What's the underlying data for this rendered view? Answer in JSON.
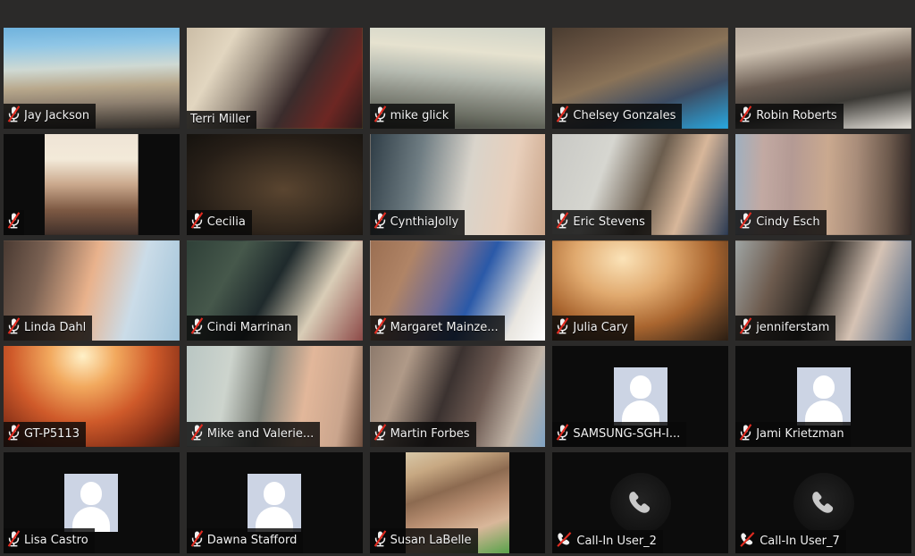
{
  "app": {
    "title": "Zoom Meeting - Gallery View",
    "background_color": "#2b2a29",
    "tile_background_color": "#0c0c0c",
    "active_speaker_border_color": "#b9df4b",
    "mute_slash_color": "#e02b20",
    "avatar_background_color": "#ccd4e4"
  },
  "icons": {
    "muted_mic": "microphone-muted-icon",
    "muted_phone": "phone-muted-icon",
    "avatar": "person-avatar-icon"
  },
  "grid": {
    "columns": 5,
    "rows": 5,
    "participant_count": 25
  },
  "participants": [
    {
      "name": "Jay Jackson",
      "has_video": true,
      "muted": true,
      "audio_type": "computer",
      "active_speaker": false,
      "video_style": "fill",
      "video_css": "linear-gradient(178deg,#6fb2dd 0%,#8fc6e6 18%,#cfd9d3 40%,#b8a88c 58%,#8e8070 74%,#2e2a26 100%)"
    },
    {
      "name": "Terri Miller",
      "has_video": true,
      "muted": false,
      "audio_type": "computer",
      "active_speaker": true,
      "video_style": "fill",
      "video_css": "linear-gradient(120deg,#cbbda6 0%,#e2d6c0 22%,#9f9384 40%,#3a2c2c 62%,#6d2723 82%,#2a1a1a 100%)"
    },
    {
      "name": "mike glick",
      "has_video": true,
      "muted": true,
      "audio_type": "computer",
      "active_speaker": false,
      "video_style": "fill",
      "video_css": "linear-gradient(185deg,#cfd3c8 0%,#e6e2cf 26%,#b7bcb2 48%,#8d9086 66%,#6a6d62 82%,#3a3c36 100%)"
    },
    {
      "name": "Chelsey Gonzales",
      "has_video": true,
      "muted": true,
      "audio_type": "computer",
      "active_speaker": false,
      "video_style": "fill",
      "video_css": "linear-gradient(160deg,#4a3c30 0%,#6b5644 25%,#8a7358 45%,#3c4c63 70%,#29a8e0 100%)"
    },
    {
      "name": "Robin Roberts",
      "has_video": true,
      "muted": true,
      "audio_type": "computer",
      "active_speaker": false,
      "video_style": "fill",
      "video_css": "linear-gradient(170deg,#b6aa9d 0%,#cbbfaf 22%,#6a5c52 48%,#3c3a36 70%,#e8e4dd 100%)"
    },
    {
      "name": "",
      "has_video": true,
      "muted": true,
      "audio_type": "computer",
      "active_speaker": false,
      "video_style": "portrait",
      "video_css": "linear-gradient(180deg,#efe4d6 0%,#f3ead9 25%,#caa88c 50%,#7e5a44 75%,#40302a 100%)"
    },
    {
      "name": "Cecilia",
      "has_video": true,
      "muted": true,
      "audio_type": "computer",
      "active_speaker": false,
      "video_style": "fill",
      "video_css": "radial-gradient(ellipse at 55% 55%,#5a4530 0%,#3c2f22 38%,#261e17 66%,#15120e 100%)"
    },
    {
      "name": "CynthiaJolly",
      "has_video": true,
      "muted": true,
      "audio_type": "computer",
      "active_speaker": false,
      "video_style": "fill",
      "video_css": "linear-gradient(100deg,#2f3d46 0%,#6f7d83 28%,#d9d4cb 55%,#e8cfbb 78%,#c9a489 100%)"
    },
    {
      "name": "Eric Stevens",
      "has_video": true,
      "muted": true,
      "audio_type": "computer",
      "active_speaker": false,
      "video_style": "fill",
      "video_css": "linear-gradient(110deg,#c8c8c4 0%,#d6d6d0 30%,#6b5d4e 55%,#d8b79a 74%,#2b3a52 100%)"
    },
    {
      "name": "Cindy Esch",
      "has_video": true,
      "muted": true,
      "audio_type": "computer",
      "active_speaker": false,
      "video_style": "fill",
      "video_css": "linear-gradient(92deg,#9fb0c0 0%,#c2a9a2 16%,#b49a94 32%,#caa98f 52%,#a98d7a 68%,#6d5a4d 86%,#2d2523 100%)"
    },
    {
      "name": "Linda Dahl",
      "has_video": true,
      "muted": true,
      "audio_type": "computer",
      "active_speaker": false,
      "video_style": "fill",
      "video_css": "linear-gradient(105deg,#4a3a32 0%,#7b6253 22%,#e9b28c 48%,#cbdce8 72%,#9fc2d8 100%)"
    },
    {
      "name": "Cindi Marrinan",
      "has_video": true,
      "muted": true,
      "audio_type": "computer",
      "active_speaker": false,
      "video_style": "fill",
      "video_css": "linear-gradient(120deg,#2f4038 0%,#46584b 26%,#1f2a2c 48%,#d9cdb7 72%,#8d4a48 100%)"
    },
    {
      "name": "Margaret Mainze...",
      "has_video": true,
      "muted": true,
      "audio_type": "computer",
      "active_speaker": false,
      "video_style": "fill",
      "video_css": "linear-gradient(115deg,#9b6f52 0%,#b08466 22%,#6e6a94 44%,#2a59a8 58%,#e9e6e0 82%,#ffffff 100%)"
    },
    {
      "name": "Julia Cary",
      "has_video": true,
      "muted": true,
      "audio_type": "computer",
      "active_speaker": false,
      "video_style": "fill",
      "video_css": "radial-gradient(ellipse at 40% 18%,#fbe3b8 0%,#e0a96e 32%,#a9652f 60%,#5d3b20 82%,#2a1d12 100%)"
    },
    {
      "name": "jenniferstam",
      "has_video": true,
      "muted": true,
      "audio_type": "computer",
      "active_speaker": false,
      "video_style": "fill",
      "video_css": "linear-gradient(110deg,#9fa5a4 0%,#6d5b4e 24%,#2a2622 46%,#d6c3b4 70%,#3e5d83 100%)"
    },
    {
      "name": "GT-P5113",
      "has_video": true,
      "muted": true,
      "audio_type": "computer",
      "active_speaker": false,
      "video_style": "fill",
      "video_css": "radial-gradient(ellipse at 45% 10%,#fff1c8 0%,#f2a95e 24%,#cf5a2a 52%,#8d3419 76%,#3a1a10 100%)"
    },
    {
      "name": "Mike and Valerie...",
      "has_video": true,
      "muted": true,
      "audio_type": "computer",
      "active_speaker": false,
      "video_style": "fill",
      "video_css": "linear-gradient(100deg,#b9c6c3 0%,#cdd4cd 24%,#7d8179 44%,#e2b79a 66%,#caa58d 86%,#6d4f3f 100%)"
    },
    {
      "name": "Martin Forbes",
      "has_video": true,
      "muted": true,
      "audio_type": "computer",
      "active_speaker": false,
      "video_style": "fill",
      "video_css": "linear-gradient(110deg,#8d7a6c 0%,#b09a88 20%,#3b3230 44%,#6d5a52 62%,#c2b5a8 82%,#7fa3c4 100%)"
    },
    {
      "name": "SAMSUNG-SGH-I...",
      "has_video": false,
      "muted": true,
      "audio_type": "computer",
      "active_speaker": false,
      "video_style": "avatar",
      "video_css": ""
    },
    {
      "name": "Jami Krietzman",
      "has_video": false,
      "muted": true,
      "audio_type": "computer",
      "active_speaker": false,
      "video_style": "avatar",
      "video_css": ""
    },
    {
      "name": "Lisa Castro",
      "has_video": false,
      "muted": true,
      "audio_type": "computer",
      "active_speaker": false,
      "video_style": "avatar",
      "video_css": ""
    },
    {
      "name": "Dawna Stafford",
      "has_video": false,
      "muted": true,
      "audio_type": "computer",
      "active_speaker": false,
      "video_style": "avatar",
      "video_css": ""
    },
    {
      "name": "Susan LaBelle",
      "has_video": true,
      "muted": true,
      "audio_type": "computer",
      "active_speaker": false,
      "video_style": "portrait-narrow",
      "video_css": "linear-gradient(160deg,#d8c8a8 0%,#c7a882 18%,#8c6a50 38%,#b98f72 56%,#d9b79a 74%,#58a24a 100%)"
    },
    {
      "name": "Call-In User_2",
      "has_video": false,
      "muted": true,
      "audio_type": "phone",
      "active_speaker": false,
      "video_style": "phone",
      "video_css": ""
    },
    {
      "name": "Call-In User_7",
      "has_video": false,
      "muted": true,
      "audio_type": "phone",
      "active_speaker": false,
      "video_style": "phone",
      "video_css": ""
    }
  ]
}
